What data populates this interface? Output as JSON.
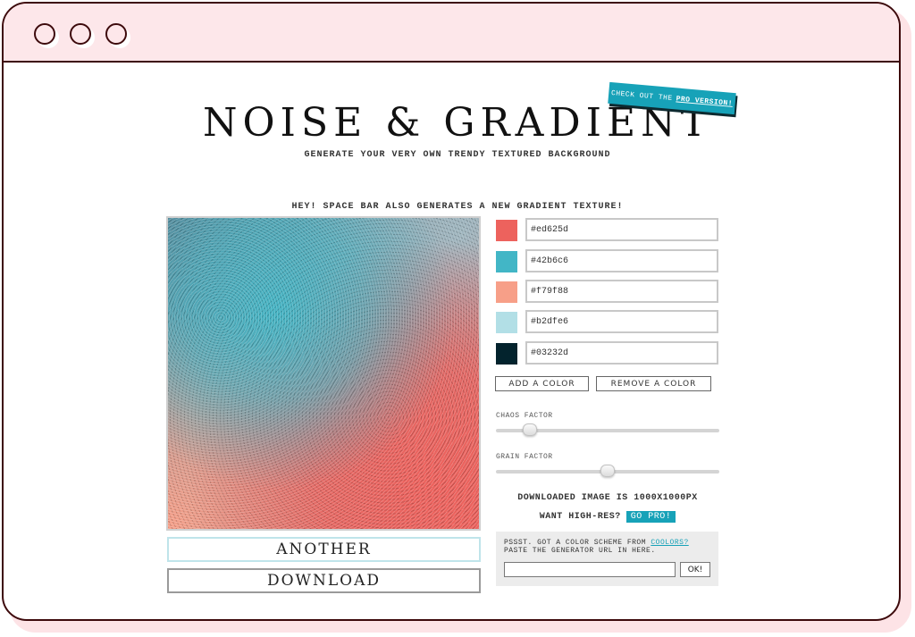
{
  "window": {
    "controls": [
      "close",
      "minimize",
      "maximize"
    ]
  },
  "header": {
    "title": "NOISE & GRADIENT",
    "subtitle": "GENERATE YOUR VERY OWN TRENDY TEXTURED BACKGROUND",
    "pro_banner": {
      "prefix": "CHECK OUT THE",
      "link": "PRO VERSION!"
    }
  },
  "hint": "HEY! SPACE BAR ALSO GENERATES A NEW GRADIENT TEXTURE!",
  "colors": [
    {
      "hex": "#ed625d",
      "value": "#ed625d"
    },
    {
      "hex": "#42b6c6",
      "value": "#42b6c6"
    },
    {
      "hex": "#f79f88",
      "value": "#f79f88"
    },
    {
      "hex": "#b2dfe6",
      "value": "#b2dfe6"
    },
    {
      "hex": "#03232d",
      "value": "#03232d"
    }
  ],
  "buttons": {
    "add_color": "ADD A COLOR",
    "remove_color": "REMOVE A COLOR",
    "another": "ANOTHER",
    "download": "DOWNLOAD"
  },
  "sliders": {
    "chaos": {
      "label": "CHAOS FACTOR",
      "value": 0.15
    },
    "grain": {
      "label": "GRAIN FACTOR",
      "value": 0.5
    }
  },
  "download_info": "DOWNLOADED IMAGE IS 1000X1000PX",
  "hires": {
    "question": "WANT HIGH-RES?",
    "button": "GO PRO!"
  },
  "coolors": {
    "line1_prefix": "PSSST. GOT A COLOR SCHEME FROM",
    "link": "COOLORS?",
    "line2": "PASTE THE GENERATOR URL IN HERE.",
    "input_value": "",
    "ok": "OK!"
  },
  "theme": {
    "accent": "#17a2b8",
    "window_border": "#3d0a0c",
    "titlebar_bg": "#fde7ea"
  }
}
